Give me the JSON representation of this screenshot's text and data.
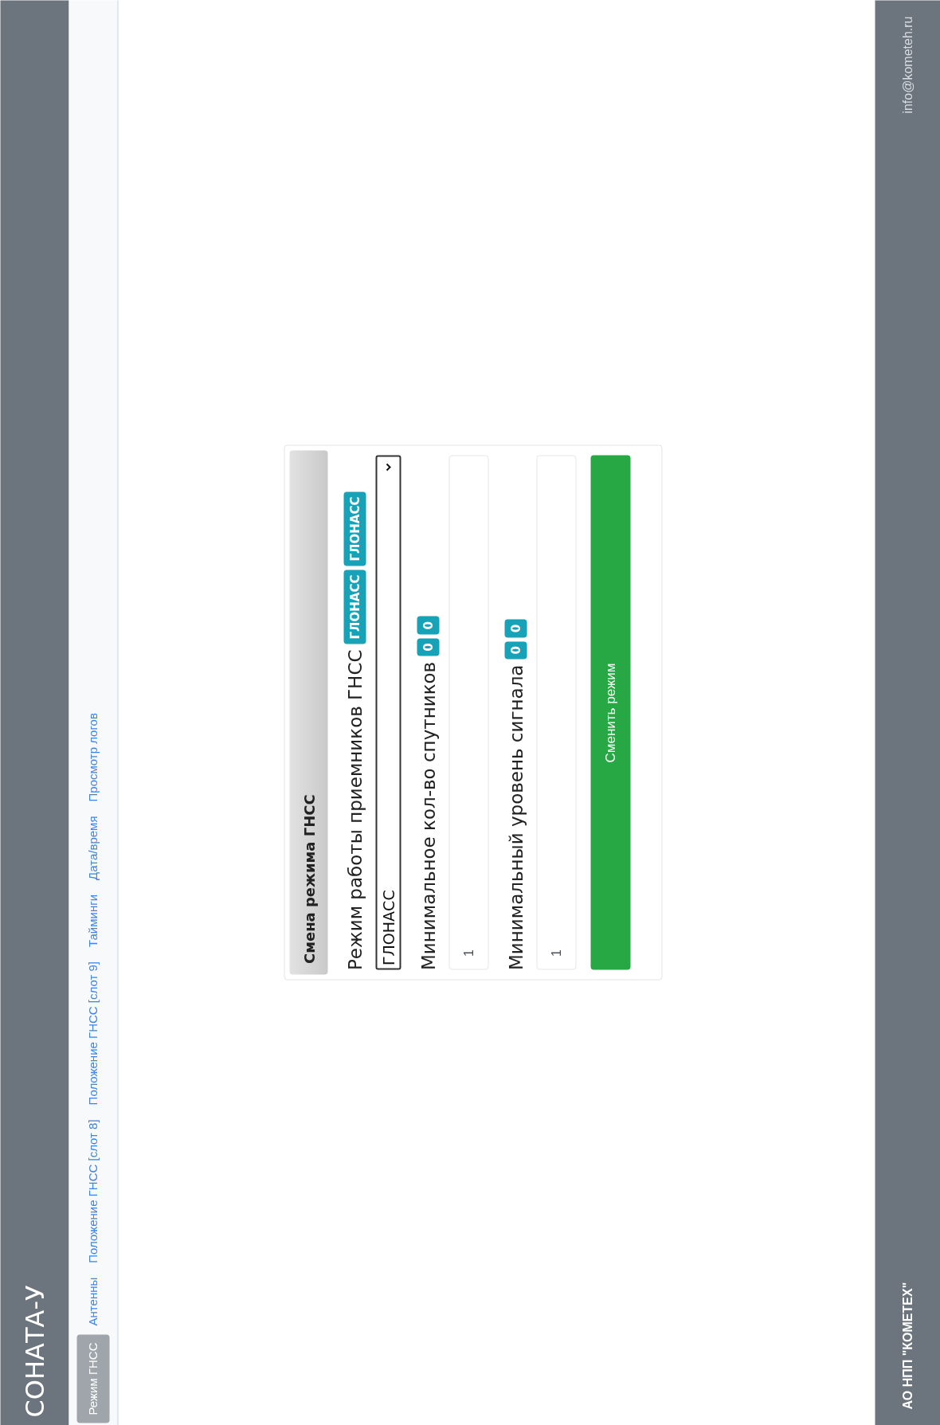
{
  "header": {
    "title": "СОНАТА-У"
  },
  "nav": [
    {
      "label": "Режим ГНСС",
      "selected": true
    },
    {
      "label": "Антенны",
      "selected": false
    },
    {
      "label": "Положение ГНСС [слот 8]",
      "selected": false
    },
    {
      "label": "Положение ГНСС [слот 9]",
      "selected": false
    },
    {
      "label": "Тайминги",
      "selected": false
    },
    {
      "label": "Дата/время",
      "selected": false
    },
    {
      "label": "Просмотр логов",
      "selected": false
    }
  ],
  "card": {
    "title": "Смена режима ГНСС",
    "fields": [
      {
        "kind": "select",
        "label": "Режим работы приемников ГНСС",
        "badges": [
          "ГЛОНАСС",
          "ГЛОНАСС"
        ],
        "value": "ГЛОНАСС"
      },
      {
        "kind": "input",
        "label": "Минимальное кол-во спутников",
        "badges": [
          "0",
          "0"
        ],
        "value": "1"
      },
      {
        "kind": "input",
        "label": "Минимальный уровень сигнала",
        "badges": [
          "0",
          "0"
        ],
        "value": "1"
      }
    ],
    "button": "Сменить режим"
  },
  "footer": {
    "company": "АО НПП \"КОМЕТЕХ\"",
    "email": "info@kometeh.ru"
  }
}
